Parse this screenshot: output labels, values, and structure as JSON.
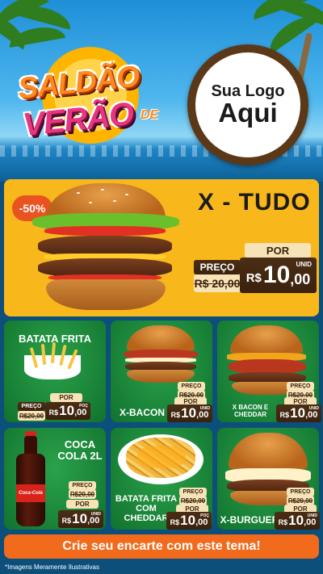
{
  "header": {
    "title_line1": "SALDÃO",
    "title_de": "DE",
    "title_line2": "VERÃO",
    "brand_line1": "Sua Logo",
    "brand_line2": "Aqui"
  },
  "hero": {
    "discount_badge": "-50%",
    "title": "X - TUDO",
    "preco_label": "PREÇO",
    "old_price": "R$ 20,00",
    "por_label": "POR",
    "currency": "R$",
    "price_int": "10",
    "price_cents": ",00",
    "unit": "UNID"
  },
  "cards": [
    {
      "name": "BATATA FRITA",
      "preco_label": "PREÇO",
      "old_price": "R$20,00",
      "por_label": "POR",
      "currency": "R$",
      "price_int": "10",
      "price_cents": ",00",
      "unit": "POÇ"
    },
    {
      "name": "X-BACON",
      "preco_label": "PREÇO",
      "old_price": "R$20,00",
      "por_label": "POR",
      "currency": "R$",
      "price_int": "10",
      "price_cents": ",00",
      "unit": "UNID"
    },
    {
      "name": "X BACON E CHEDDAR",
      "preco_label": "PREÇO",
      "old_price": "R$20,00",
      "por_label": "POR",
      "currency": "R$",
      "price_int": "10",
      "price_cents": ",00",
      "unit": "UNID"
    },
    {
      "name": "COCA COLA 2L",
      "preco_label": "PREÇO",
      "old_price": "R$20,00",
      "por_label": "POR",
      "currency": "R$",
      "price_int": "10",
      "price_cents": ",00",
      "unit": "UNID"
    },
    {
      "name": "BATATA FRITA COM CHEDDAR",
      "preco_label": "PREÇO",
      "old_price": "R$20,00",
      "por_label": "POR",
      "currency": "R$",
      "price_int": "10",
      "price_cents": ",00",
      "unit": "POÇ"
    },
    {
      "name": "X-BURGUER",
      "preco_label": "PREÇO",
      "old_price": "R$20,00",
      "por_label": "POR",
      "currency": "R$",
      "price_int": "10",
      "price_cents": ",00",
      "unit": "UNID"
    }
  ],
  "cola_label": "Coca-Cola",
  "cta": "Crie seu encarte com este tema!",
  "footnote": "*Imagens Meramente Ilustrativas",
  "colors": {
    "hero_bg": "#f8b81c",
    "card_green": "#1c8a3c",
    "wood": "#3b220e",
    "cta_orange": "#f26a1b",
    "badge_orange": "#e8531f"
  }
}
